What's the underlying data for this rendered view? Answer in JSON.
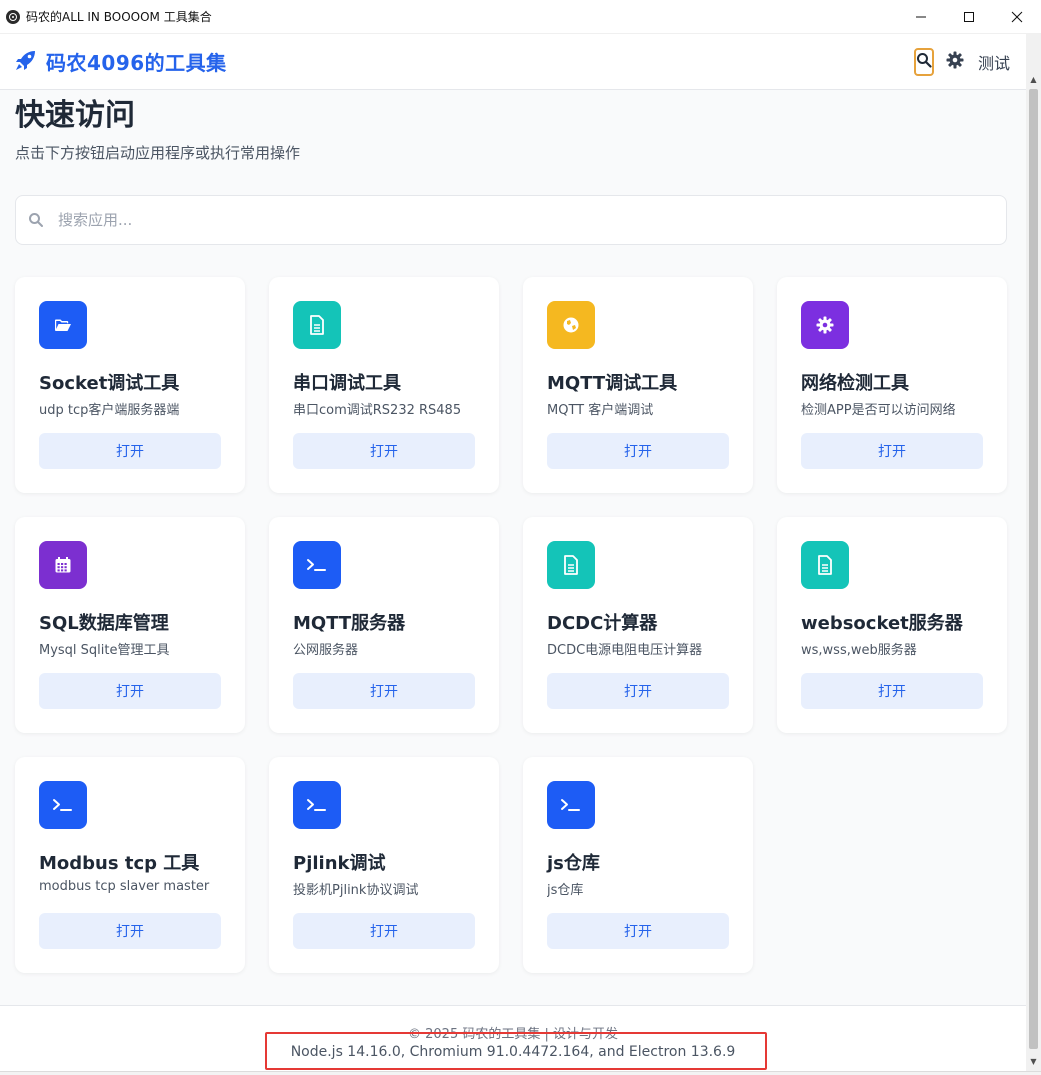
{
  "window": {
    "title": "码农的ALL IN BOOOOM 工具集合",
    "controls": [
      "minimize",
      "maximize",
      "close"
    ]
  },
  "header": {
    "brand_icon": "rocket-icon",
    "brand_title": "码农4096的工具集",
    "search_icon": "search-icon",
    "settings_icon": "gear-icon",
    "test_link": "测试"
  },
  "main": {
    "title": "快速访问",
    "subtitle": "点击下方按钮启动应用程序或执行常用操作",
    "search": {
      "placeholder": "搜索应用..."
    },
    "cards": [
      {
        "title": "Socket调试工具",
        "desc": "udp tcp客户端服务器端",
        "button": "打开",
        "icon": "folder-open-icon",
        "color": "#1d5cf5"
      },
      {
        "title": "串口调试工具",
        "desc": "串口com调试RS232 RS485",
        "button": "打开",
        "icon": "document-icon",
        "color": "#14c4b8"
      },
      {
        "title": "MQTT调试工具",
        "desc": "MQTT 客户端调试",
        "button": "打开",
        "icon": "globe-icon",
        "color": "#f5b820"
      },
      {
        "title": "网络检测工具",
        "desc": "检测APP是否可以访问网络",
        "button": "打开",
        "icon": "gear-icon",
        "color": "#7c2fe0"
      },
      {
        "title": "SQL数据库管理",
        "desc": "Mysql Sqlite管理工具",
        "button": "打开",
        "icon": "calendar-icon",
        "color": "#7c2fd0"
      },
      {
        "title": "MQTT服务器",
        "desc": "公网服务器",
        "button": "打开",
        "icon": "terminal-icon",
        "color": "#1d5cf5"
      },
      {
        "title": "DCDC计算器",
        "desc": "DCDC电源电阻电压计算器",
        "button": "打开",
        "icon": "document-icon",
        "color": "#14c4b8"
      },
      {
        "title": "websocket服务器",
        "desc": "ws,wss,web服务器",
        "button": "打开",
        "icon": "document-icon",
        "color": "#14c4b8"
      },
      {
        "title": "Modbus tcp 工具",
        "desc": "modbus tcp slaver master",
        "button": "打开",
        "icon": "terminal-icon",
        "color": "#1d5cf5"
      },
      {
        "title": "Pjlink调试",
        "desc": "投影机Pjlink协议调试",
        "button": "打开",
        "icon": "terminal-icon",
        "color": "#1d5cf5"
      },
      {
        "title": "js仓库",
        "desc": "js仓库",
        "button": "打开",
        "icon": "terminal-icon",
        "color": "#1d5cf5"
      }
    ]
  },
  "footer": {
    "copyright": "© 2025 码农的工具集 | 设计与开发",
    "versions": "Node.js 14.16.0, Chromium 91.0.4472.164, and Electron 13.6.9"
  },
  "colors": {
    "brand": "#2563eb",
    "button_bg": "#e8effd",
    "highlight": "#e53935",
    "search_focus": "#e6a23c"
  }
}
